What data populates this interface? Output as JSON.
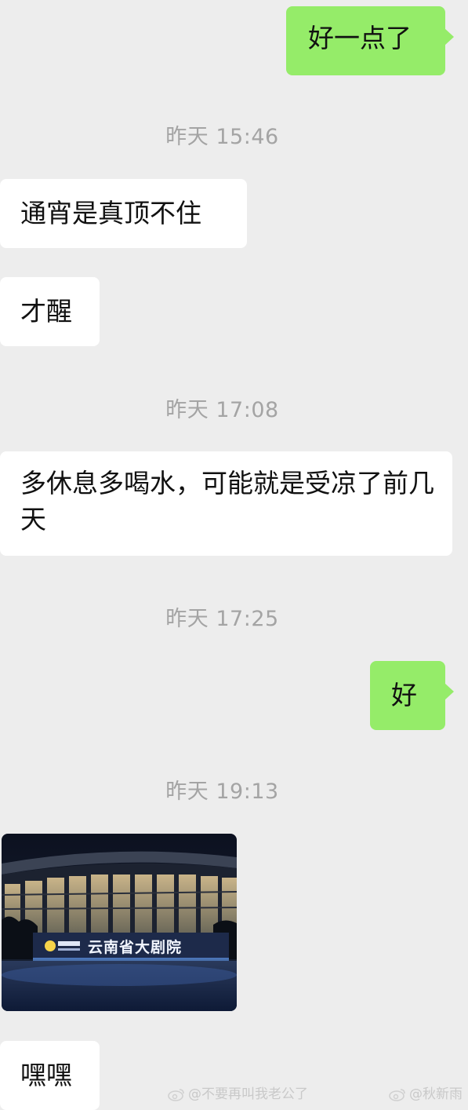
{
  "messages": [
    {
      "direction": "out",
      "text": "好一点了"
    },
    {
      "type": "time",
      "text": "昨天 15:46"
    },
    {
      "direction": "in",
      "text": "通宵是真顶不住"
    },
    {
      "direction": "in",
      "text": "才醒"
    },
    {
      "type": "time",
      "text": "昨天 17:08"
    },
    {
      "direction": "in",
      "text": "多休息多喝水，可能就是受凉了前几天"
    },
    {
      "type": "time",
      "text": "昨天 17:25"
    },
    {
      "direction": "out",
      "text": "好"
    },
    {
      "type": "time",
      "text": "昨天 19:13"
    },
    {
      "direction": "in",
      "type": "image",
      "sign_text": "云南省大剧院"
    },
    {
      "direction": "in",
      "text": "嘿嘿"
    }
  ],
  "watermarks": {
    "left": "@不要再叫我老公了",
    "right": "@秋新雨"
  },
  "colors": {
    "background": "#ededed",
    "incoming_bubble": "#ffffff",
    "outgoing_bubble": "#95ec69",
    "timestamp": "#a4a4a4"
  }
}
